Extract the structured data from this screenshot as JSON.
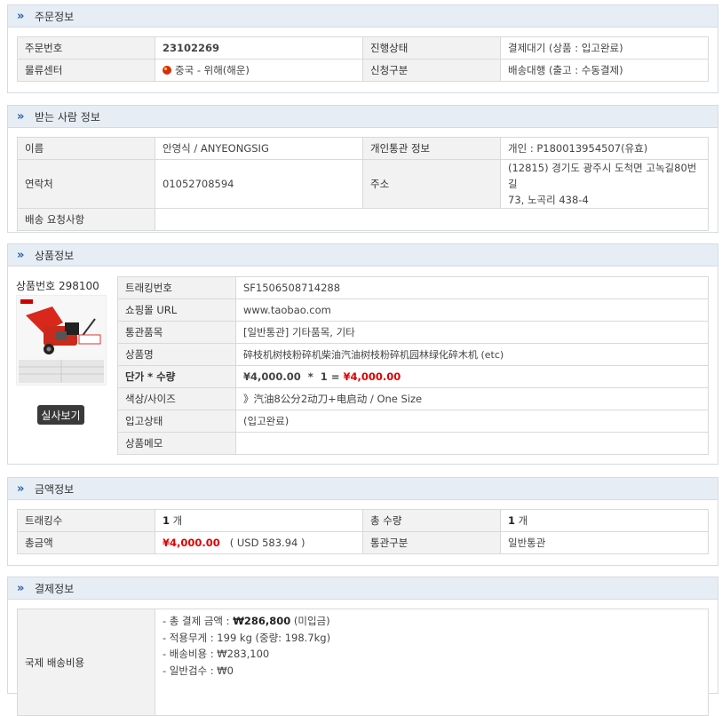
{
  "sections": {
    "order": "주문정보",
    "recipient": "받는 사람 정보",
    "product": "상품정보",
    "amount": "금액정보",
    "payment": "결제정보"
  },
  "order": {
    "order_no_label": "주문번호",
    "order_no": "23102269",
    "status_label": "진행상태",
    "status": "결제대기 (상품 : 입고완료)",
    "center_label": "물류센터",
    "center": "중국 - 위해(해운)",
    "request_label": "신청구분",
    "request": "배송대행 (출고 : 수동결제)"
  },
  "recipient": {
    "name_label": "이름",
    "name": "안영식 / ANYEONGSIG",
    "customs_label": "개인통관 정보",
    "customs": "개인 : P180013954507(유효)",
    "phone_label": "연락처",
    "phone": "01052708594",
    "address_label": "주소",
    "address_line1": "(12815) 경기도 광주시 도척면 고녹길80번길",
    "address_line2": "73, 노곡리 438-4",
    "request_label": "배송 요청사항",
    "request": ""
  },
  "product": {
    "product_no": "상품번호 298100",
    "view_button": "실사보기",
    "tracking_label": "트래킹번호",
    "tracking": "SF1506508714288",
    "mall_label": "쇼핑몰 URL",
    "mall": "www.taobao.com",
    "customs_item_label": "통관품목",
    "customs_item": "[일반통관] 기타품목, 기타",
    "name_label": "상품명",
    "name": "碎枝机树枝粉碎机柴油汽油树枝粉碎机园林绿化碎木机 (etc)",
    "price_label": "단가 * 수량",
    "unit_price": "¥4,000.00",
    "times": "*",
    "qty": "1",
    "equals": "=",
    "total": "¥4,000.00",
    "option_label": "색상/사이즈",
    "option": "》汽油8公分2动刀+电启动 / One Size",
    "inbound_label": "입고상태",
    "inbound": "(입고완료)",
    "memo_label": "상품메모",
    "memo": ""
  },
  "amount": {
    "tracking_count_label": "트래킹수",
    "tracking_count": "1",
    "unit": "개",
    "total_qty_label": "총 수량",
    "total_qty": "1",
    "total_label": "총금액",
    "total": "¥4,000.00",
    "total_usd": "( USD 583.94 )",
    "customs_type_label": "통관구분",
    "customs_type": "일반통관"
  },
  "payment": {
    "shipping_label": "국제 배송비용",
    "total_prefix": "- 총 결제 금액 : ",
    "total": "₩286,800",
    "total_suffix": " (미입금)",
    "weight": "- 적용무게 : 199 kg (중량: 198.7kg)",
    "shipping_cost": "- 배송비용 : ₩283,100",
    "inspection": "- 일반검수 : ₩0"
  },
  "colors": {
    "header_bg": "#e6edf5",
    "label_bg": "#f2f2f2",
    "price_red": "#e00000",
    "link_blue": "#2b4fb0"
  }
}
